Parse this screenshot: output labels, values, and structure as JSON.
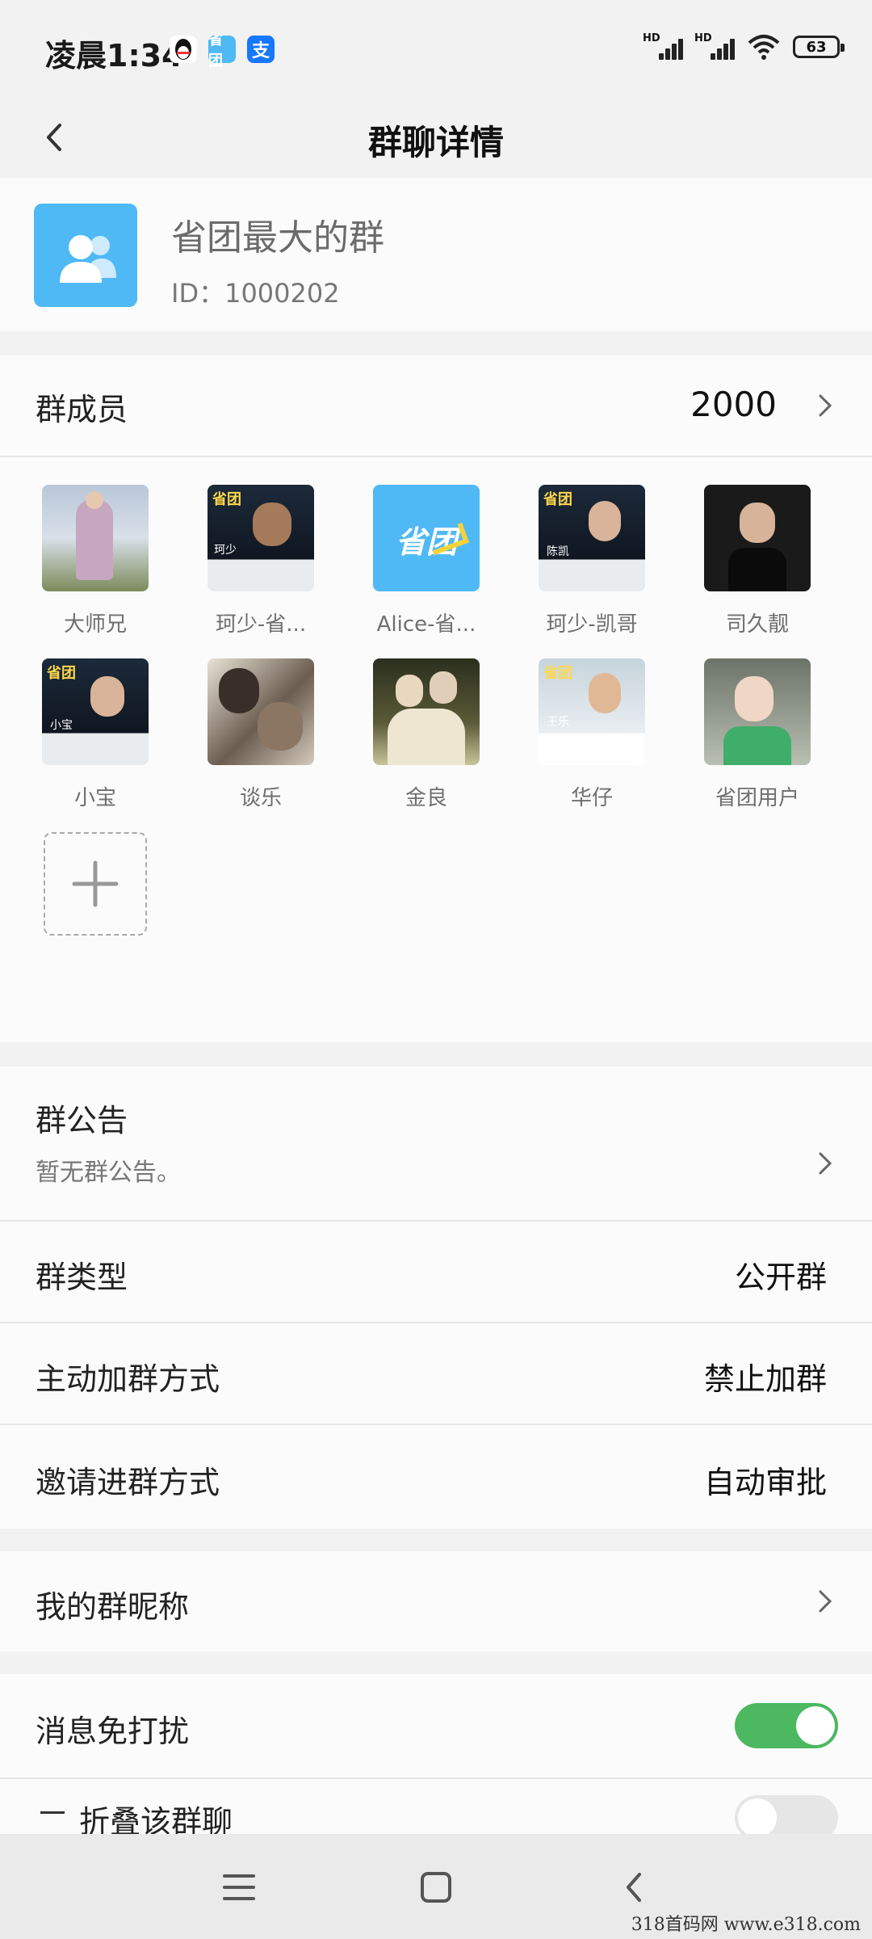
{
  "status_bar": {
    "time": "凌晨1:34",
    "apps": [
      "qq-icon",
      "shengtuan-app-icon",
      "alipay-icon"
    ],
    "app_labels": [
      "",
      "省团",
      "支"
    ],
    "signal_labels": [
      "HD",
      "HD"
    ],
    "battery": "63"
  },
  "nav": {
    "title": "群聊详情",
    "back_icon": "chevron-left-icon"
  },
  "group": {
    "name": "省团最大的群",
    "id_text": "ID：1000202"
  },
  "members": {
    "title": "群成员",
    "count": "2000",
    "list": [
      {
        "name": "大师兄",
        "badge": ""
      },
      {
        "name": "珂少-省...",
        "badge": "珂少"
      },
      {
        "name": "Alice-省...",
        "badge": "省团"
      },
      {
        "name": "珂少-凯哥",
        "badge": "陈凯"
      },
      {
        "name": "司久靓",
        "badge": ""
      },
      {
        "name": "小宝",
        "badge": "小宝"
      },
      {
        "name": "谈乐",
        "badge": ""
      },
      {
        "name": "金良",
        "badge": ""
      },
      {
        "name": "华仔",
        "badge": "王乐"
      },
      {
        "name": "省团用户",
        "badge": ""
      }
    ],
    "add_icon": "plus-icon"
  },
  "announcement": {
    "title": "群公告",
    "value": "暂无群公告。"
  },
  "group_type": {
    "title": "群类型",
    "value": "公开群"
  },
  "join_method": {
    "title": "主动加群方式",
    "value": "禁止加群"
  },
  "invite_method": {
    "title": "邀请进群方式",
    "value": "自动审批"
  },
  "nickname": {
    "title": "我的群昵称"
  },
  "mute": {
    "title": "消息免打扰",
    "on": true
  },
  "fold": {
    "title": "折叠该群聊",
    "on": false
  },
  "colors": {
    "accent": "#4cb860",
    "avatar_blue": "#4fb9f5"
  },
  "watermark": "318首码网  www.e318.com"
}
